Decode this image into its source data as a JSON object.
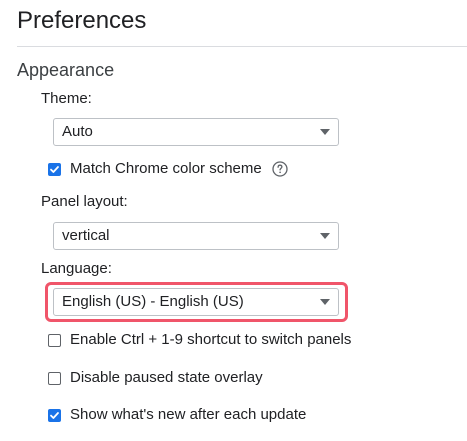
{
  "page": {
    "title": "Preferences"
  },
  "appearance": {
    "section_title": "Appearance",
    "theme": {
      "label": "Theme:",
      "value": "Auto"
    },
    "match_chrome": {
      "label": "Match Chrome color scheme",
      "checked": true,
      "help_icon": "help-circle-icon"
    },
    "panel_layout": {
      "label": "Panel layout:",
      "value": "vertical"
    },
    "language": {
      "label": "Language:",
      "value": "English (US) - English (US)",
      "highlighted": true
    },
    "options": [
      {
        "label": "Enable Ctrl + 1-9 shortcut to switch panels",
        "checked": false
      },
      {
        "label": "Disable paused state overlay",
        "checked": false
      },
      {
        "label": "Show what's new after each update",
        "checked": true
      }
    ]
  },
  "colors": {
    "accent": "#1a73e8",
    "highlight": "#f0556a",
    "divider": "#dadce0"
  }
}
